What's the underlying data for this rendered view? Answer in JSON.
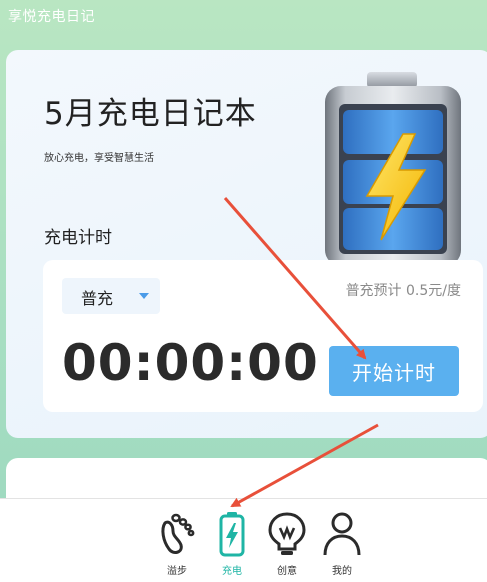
{
  "app": {
    "title": "享悦充电日记"
  },
  "hero": {
    "title": "5月充电日记本",
    "subtitle": "放心充电，享受智慧生活",
    "section_label": "充电计时"
  },
  "timer": {
    "mode_selected": "普充",
    "price_text": "普充预计 0.5元/度",
    "display": "00:00:00",
    "start_label": "开始计时"
  },
  "tabbar": {
    "items": [
      {
        "label": "溢步",
        "icon": "footprint-icon",
        "active": false
      },
      {
        "label": "充电",
        "icon": "battery-charging-icon",
        "active": true
      },
      {
        "label": "创意",
        "icon": "lightbulb-icon",
        "active": false
      },
      {
        "label": "我的",
        "icon": "person-icon",
        "active": false
      }
    ]
  },
  "colors": {
    "accent": "#5ab0ef",
    "active_tab": "#1fb5a5",
    "background_green": "#a9dfc2",
    "annotation_arrow": "#e8503a"
  }
}
